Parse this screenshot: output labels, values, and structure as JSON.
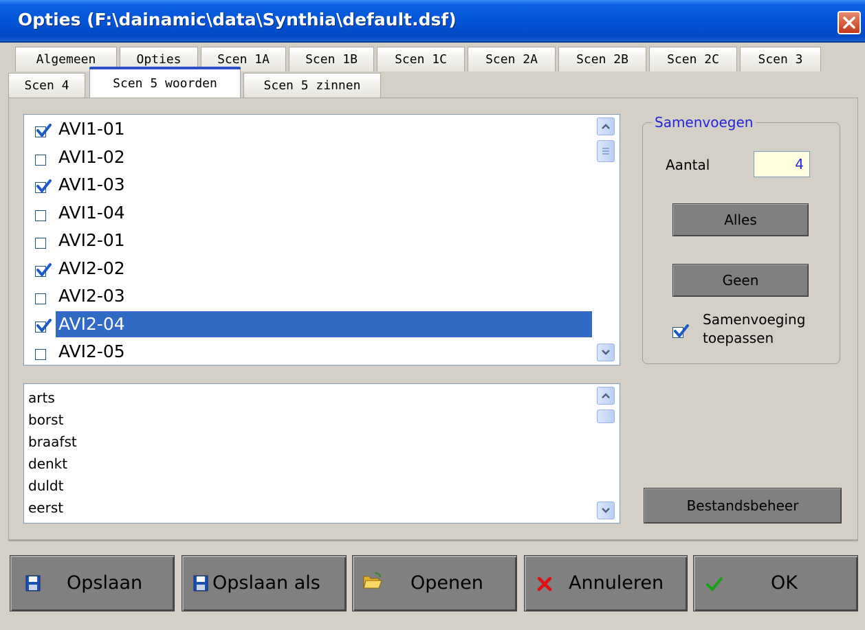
{
  "window": {
    "title": "Opties (F:\\dainamic\\data\\Synthia\\default.dsf)"
  },
  "tabs_row1": [
    "Algemeen",
    "Opties",
    "Scen 1A",
    "Scen 1B",
    "Scen 1C",
    "Scen 2A",
    "Scen 2B",
    "Scen 2C",
    "Scen 3"
  ],
  "tabs_row2": [
    "Scen 4",
    "Scen 5 woorden",
    "Scen 5 zinnen"
  ],
  "active_tab": "Scen 5 woorden",
  "checklist": [
    {
      "label": "AVI1-01",
      "checked": true
    },
    {
      "label": "AVI1-02",
      "checked": false
    },
    {
      "label": "AVI1-03",
      "checked": true
    },
    {
      "label": "AVI1-04",
      "checked": false
    },
    {
      "label": "AVI2-01",
      "checked": false
    },
    {
      "label": "AVI2-02",
      "checked": true
    },
    {
      "label": "AVI2-03",
      "checked": false
    },
    {
      "label": "AVI2-04",
      "checked": true,
      "selected": true
    },
    {
      "label": "AVI2-05",
      "checked": false
    }
  ],
  "words": [
    "arts",
    "borst",
    "braafst",
    "denkt",
    "duldt",
    "eerst"
  ],
  "samenvoegen": {
    "legend": "Samenvoegen",
    "aantal_label": "Aantal",
    "aantal_value": "4",
    "alles_label": "Alles",
    "geen_label": "Geen",
    "samenvoeging_line1": "Samenvoeging",
    "samenvoeging_line2": "toepassen",
    "samenvoeging_checked": true
  },
  "bestandsbeheer_label": "Bestandsbeheer",
  "buttons": {
    "opslaan": "Opslaan",
    "opslaan_als": "Opslaan als",
    "openen": "Openen",
    "annuleren": "Annuleren",
    "ok": "OK"
  },
  "colors": {
    "titlebar": "#0355d8",
    "selection": "#316ac5",
    "legend": "#2424d8",
    "check": "#1c5ac8"
  },
  "icons": [
    "close-icon",
    "checkmark-icon",
    "scroll-up-icon",
    "scroll-down-icon",
    "floppy-disk-icon",
    "folder-open-icon",
    "red-x-icon",
    "green-check-icon"
  ]
}
